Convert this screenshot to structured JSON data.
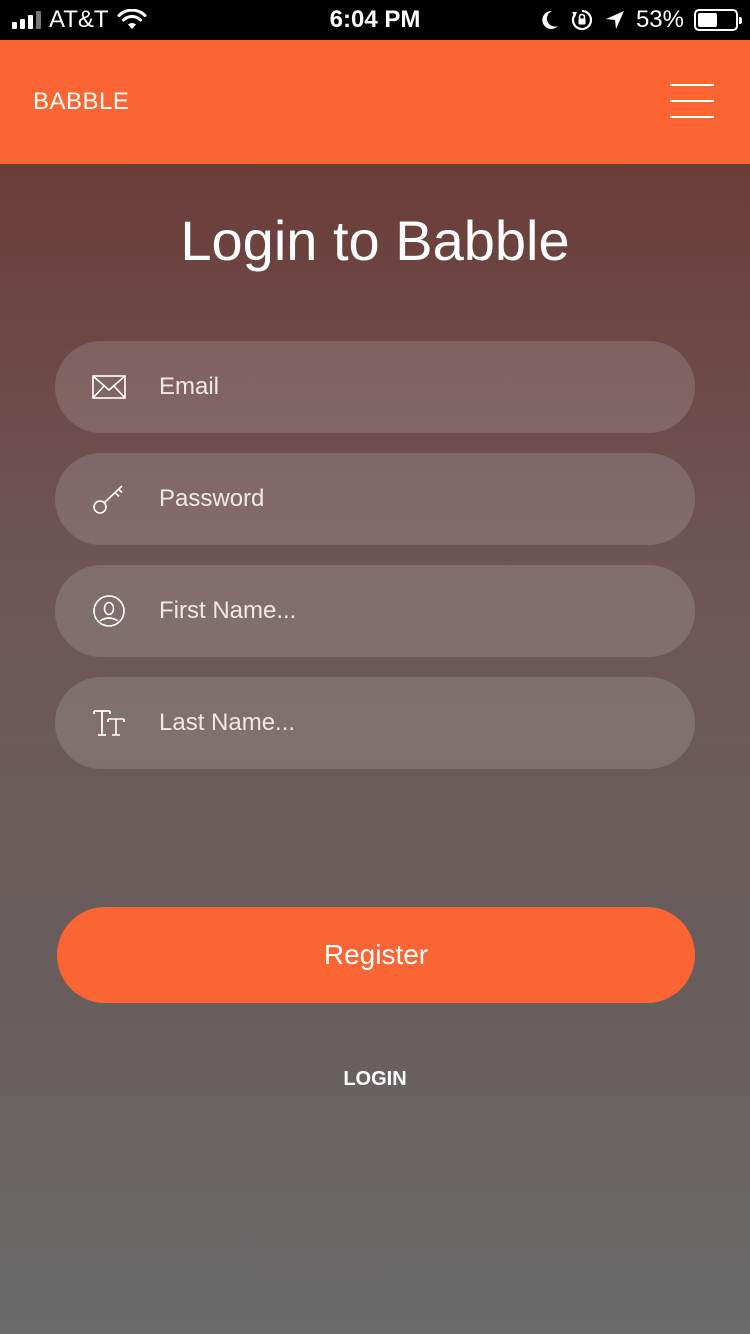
{
  "status_bar": {
    "carrier": "AT&T",
    "time": "6:04 PM",
    "battery_percent": "53%",
    "battery_level": 0.53,
    "icons": [
      "signal-icon",
      "wifi-icon",
      "moon-icon",
      "rotation-lock-icon",
      "location-arrow-icon",
      "battery-icon"
    ]
  },
  "header": {
    "brand": "BABBLE",
    "menu_icon": "hamburger-menu-icon",
    "color": "#fb6433"
  },
  "main": {
    "title": "Login to Babble",
    "fields": [
      {
        "icon": "envelope-icon",
        "placeholder": "Email",
        "value": ""
      },
      {
        "icon": "key-icon",
        "placeholder": "Password",
        "value": ""
      },
      {
        "icon": "user-circle-icon",
        "placeholder": "First Name...",
        "value": ""
      },
      {
        "icon": "text-icon",
        "placeholder": "Last Name...",
        "value": ""
      }
    ],
    "register_label": "Register",
    "login_label": "LOGIN"
  },
  "colors": {
    "accent": "#fb6433",
    "gradient_top": "#6b3d38",
    "gradient_bottom": "#6b6b6b"
  }
}
